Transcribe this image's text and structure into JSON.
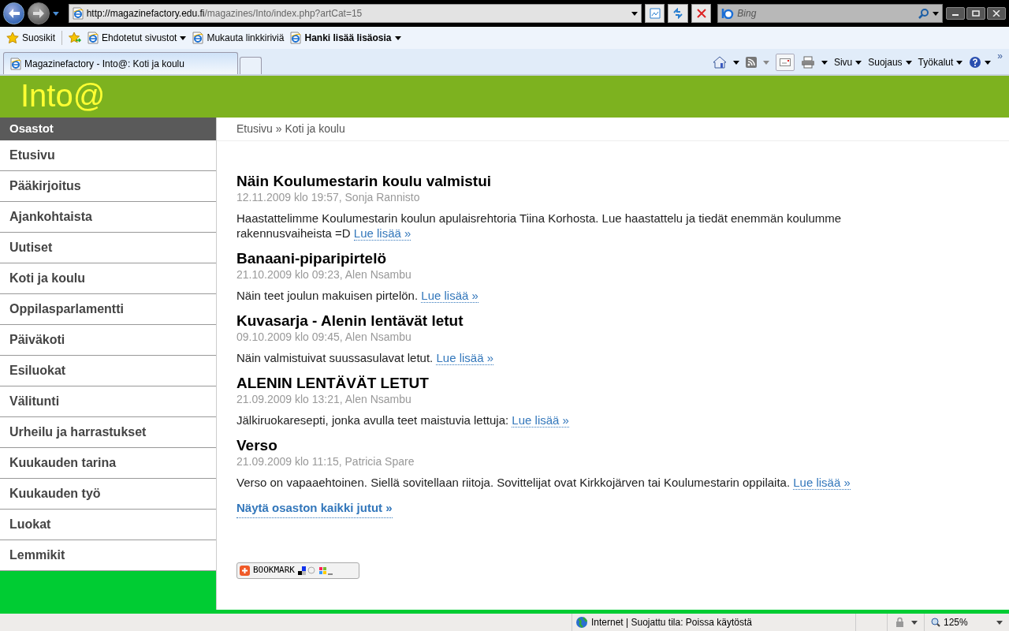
{
  "browser": {
    "address_host": "http://magazinefactory.edu.fi",
    "address_path": "/magazines/Into/index.php?artCat=15",
    "search_placeholder": "Bing",
    "favorites": [
      {
        "label": "Suosikit",
        "kind": "star",
        "bold": false,
        "dropdown": false
      },
      {
        "label": "Ehdotetut sivustot",
        "kind": "page",
        "bold": false,
        "dropdown": true
      },
      {
        "label": "Mukauta linkkiriviä",
        "kind": "page",
        "bold": false,
        "dropdown": false
      },
      {
        "label": "Hanki lisää lisäosia",
        "kind": "page",
        "bold": true,
        "dropdown": true
      }
    ],
    "tab": {
      "title": "Magazinefactory - Into@: Koti ja koulu",
      "selected": true
    },
    "commands": [
      "Sivu",
      "Suojaus",
      "Työkalut"
    ],
    "chevron": "»",
    "status": "Internet | Suojattu tila: Poissa käytöstä",
    "zoom": "125%"
  },
  "site": {
    "logo": "Into@",
    "sidebar": {
      "heading": "Osastot",
      "items": [
        "Etusivu",
        "Pääkirjoitus",
        "Ajankohtaista",
        "Uutiset",
        "Koti ja koulu",
        "Oppilasparlamentti",
        "Päiväkoti",
        "Esiluokat",
        "Välitunti",
        "Urheilu ja harrastukset",
        "Kuukauden tarina",
        "Kuukauden työ",
        "Luokat",
        "Lemmikit"
      ]
    },
    "breadcrumb": "Etusivu » Koti ja koulu",
    "articles": [
      {
        "title": "Näin Koulumestarin koulu valmistui",
        "meta": "12.11.2009 klo 19:57, Sonja Rannisto",
        "summary": "Haastattelimme Koulumestarin koulun apulaisrehtoria Tiina Korhosta. Lue haastattelu ja tiedät enemmän koulumme rakennusvaiheista =D",
        "link": "Lue lisää »"
      },
      {
        "title": "Banaani-piparipirtelö",
        "meta": "21.10.2009 klo 09:23, Alen Nsambu",
        "summary": "Näin teet joulun makuisen pirtelön.",
        "link": "Lue lisää »"
      },
      {
        "title": "Kuvasarja - Alenin lentävät letut",
        "meta": "09.10.2009 klo 09:45, Alen Nsambu",
        "summary": "Näin valmistuivat suussasulavat letut.",
        "link": "Lue lisää »"
      },
      {
        "title": "ALENIN LENTÄVÄT LETUT",
        "meta": "21.09.2009 klo 13:21, Alen Nsambu",
        "summary": "Jälkiruokaresepti, jonka avulla teet maistuvia lettuja:",
        "link": "Lue lisää »"
      },
      {
        "title": "Verso",
        "meta": "21.09.2009 klo 11:15, Patricia Spare",
        "summary": "Verso on vapaaehtoinen. Siellä sovitellaan riitoja. Sovittelijat ovat Kirkkojärven tai Koulumestarin oppilaita.",
        "link": "Lue lisää »"
      }
    ],
    "all_link": "Näytä osaston kaikki jutut »",
    "bookmark": "BOOKMARK"
  }
}
